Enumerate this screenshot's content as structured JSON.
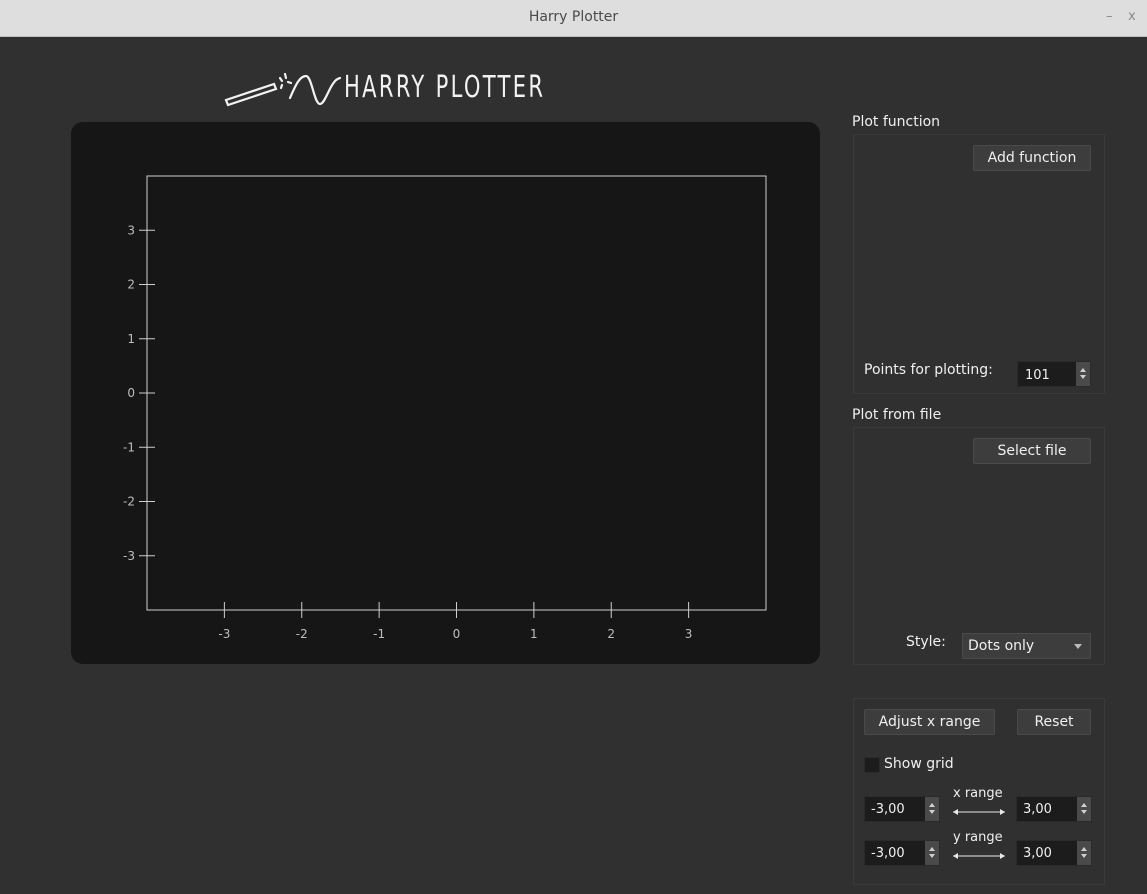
{
  "window": {
    "title": "Harry Plotter",
    "minimize": "–",
    "close": "x"
  },
  "logo": {
    "text": "HARRY PLOTTER"
  },
  "chart_data": {
    "type": "line",
    "title": "",
    "xlabel": "",
    "ylabel": "",
    "xlim": [
      -4,
      4
    ],
    "ylim": [
      -4,
      4
    ],
    "xticks": [
      -3,
      -2,
      -1,
      0,
      1,
      2,
      3
    ],
    "yticks": [
      -3,
      -2,
      -1,
      0,
      1,
      2,
      3
    ],
    "grid": false,
    "series": []
  },
  "plot_function": {
    "title": "Plot function",
    "add_button": "Add function",
    "points_label": "Points for plotting:",
    "points_value": "101"
  },
  "plot_from_file": {
    "title": "Plot from file",
    "select_button": "Select file",
    "style_label": "Style:",
    "style_value": "Dots only"
  },
  "range_controls": {
    "adjust_button": "Adjust x range",
    "reset_button": "Reset",
    "show_grid_label": "Show grid",
    "show_grid_checked": false,
    "x_range_label": "x range",
    "y_range_label": "y range",
    "x_min": "-3,00",
    "x_max": "3,00",
    "y_min": "-3,00",
    "y_max": "3,00"
  }
}
